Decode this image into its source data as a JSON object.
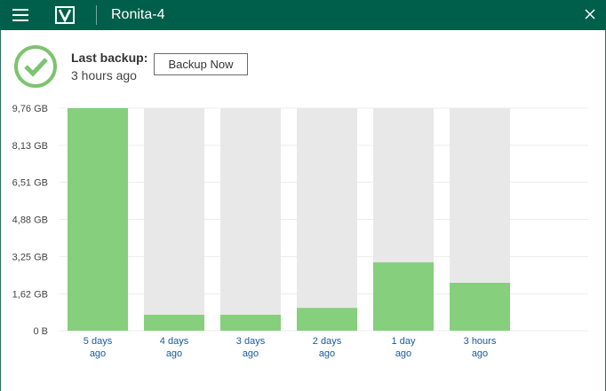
{
  "window": {
    "title": "Ronita-4",
    "menu_icon": "hamburger-menu-icon",
    "logo_icon": "veeam-logo-icon",
    "close_icon": "close-icon"
  },
  "status": {
    "icon": "checkmark-circle-icon",
    "label": "Last backup:",
    "time": "3 hours ago",
    "button_label": "Backup Now"
  },
  "colors": {
    "titlebar": "#005f4b",
    "bar_used": "#86cf7c",
    "bar_capacity": "#e9e8e9",
    "status_green": "#7cc46f"
  },
  "chart_data": {
    "type": "bar",
    "categories": [
      [
        "5 days",
        "ago"
      ],
      [
        "4 days",
        "ago"
      ],
      [
        "3 days",
        "ago"
      ],
      [
        "2 days",
        "ago"
      ],
      [
        "1 day",
        "ago"
      ],
      [
        "3 hours",
        "ago"
      ]
    ],
    "series": [
      {
        "values": [
          9.76,
          0.7,
          0.7,
          1.0,
          3.0,
          2.1
        ]
      }
    ],
    "capacity": 9.76,
    "ylim": [
      0,
      9.76
    ],
    "yticks": [
      0,
      1.62,
      3.25,
      4.88,
      6.51,
      8.13,
      9.76
    ],
    "ytick_labels": [
      "0 B",
      "1,62 GB",
      "3,25 GB",
      "4,88 GB",
      "6,51 GB",
      "8,13 GB",
      "9,76 GB"
    ],
    "grid": true
  }
}
